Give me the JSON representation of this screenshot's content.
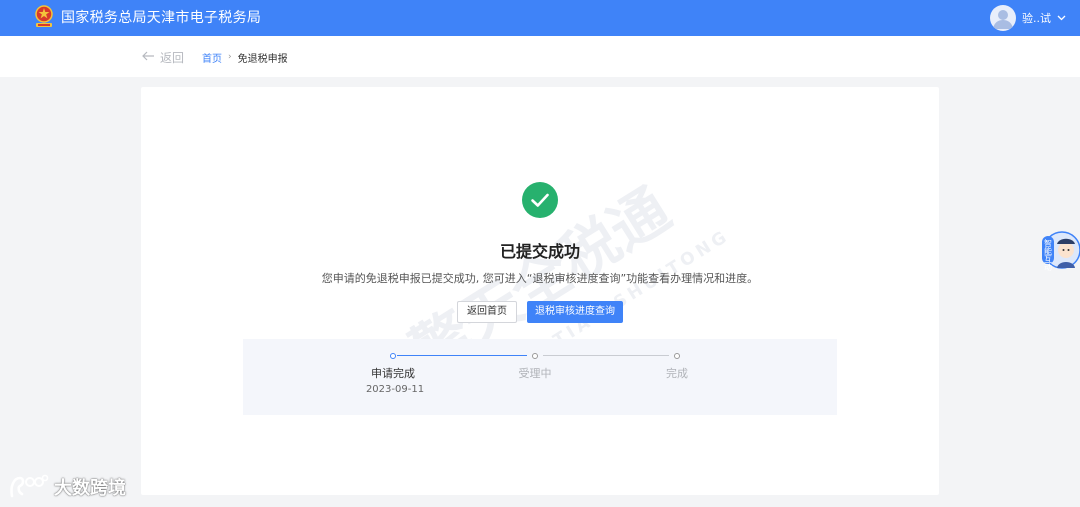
{
  "header": {
    "site_title": "国家税务总局天津市电子税务局",
    "user_name": "验..试",
    "brand_color": "#3f83f8"
  },
  "breadcrumb": {
    "back_label": "返回",
    "home_label": "首页",
    "separator": "›",
    "current_label": "免退税申报"
  },
  "result": {
    "title": "已提交成功",
    "description": "您申请的免退税申报已提交成功, 您可进入“退税审核进度查询”功能查看办理情况和进度。",
    "status_color": "#27b16e"
  },
  "actions": {
    "home_button": "返回首页",
    "query_button": "退税审核进度查询"
  },
  "progress": {
    "steps": [
      {
        "label": "申请完成",
        "date": "2023-09-11",
        "done": true
      },
      {
        "label": "受理中",
        "date": "",
        "done": false
      },
      {
        "label": "完成",
        "date": "",
        "done": false
      }
    ]
  },
  "watermark": {
    "cn": "擎天全税通",
    "en": "QINGTIAN SHUITONG"
  },
  "floating_helper": {
    "label": "智能互动"
  },
  "corner_brand": {
    "text": "大数跨境"
  }
}
